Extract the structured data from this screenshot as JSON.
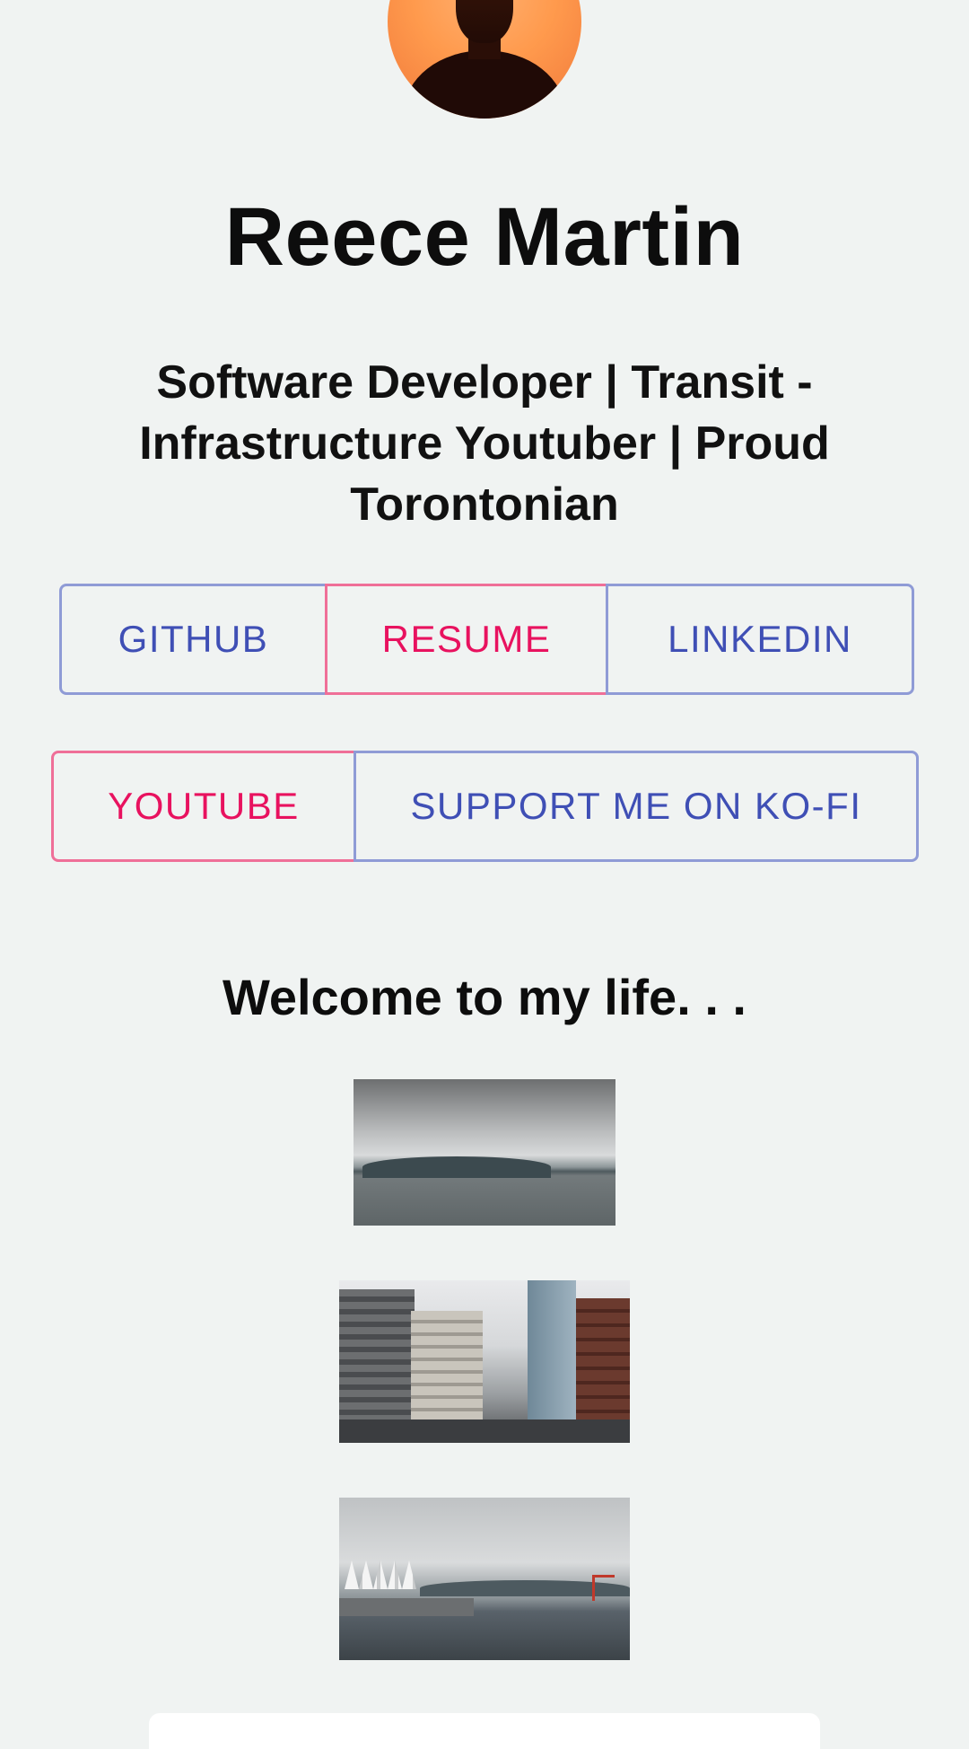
{
  "profile": {
    "name": "Reece Martin",
    "tagline": "Software Developer | Transit - Infrastructure Youtuber | Proud Torontonian",
    "avatar_alt": "profile photo"
  },
  "links_row1": [
    {
      "label": "GITHUB",
      "color": "#3f4fb5"
    },
    {
      "label": "RESUME",
      "color": "#e8125f"
    },
    {
      "label": "LINKEDIN",
      "color": "#3f4fb5"
    }
  ],
  "links_row2": [
    {
      "label": "YOUTUBE",
      "color": "#e8125f"
    },
    {
      "label": "SUPPORT ME ON KO-FI",
      "color": "#3f4fb5"
    }
  ],
  "gallery": {
    "heading": "Welcome to my life. . .",
    "photos": [
      {
        "subject": "harbour and mountains under cloudy sky"
      },
      {
        "subject": "downtown street with buildings"
      },
      {
        "subject": "waterfront with white sails and cranes"
      }
    ]
  }
}
